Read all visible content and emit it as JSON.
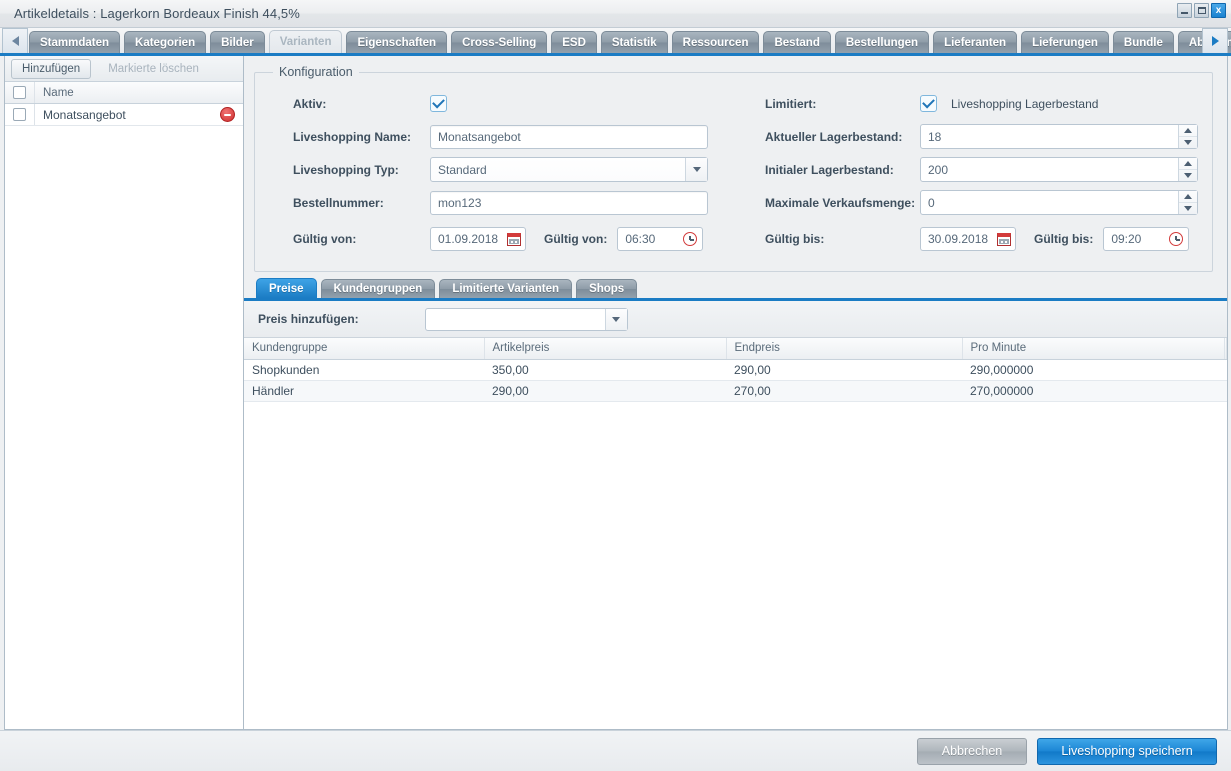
{
  "window": {
    "title": "Artikeldetails : Lagerkorn Bordeaux Finish 44,5%",
    "controls": {
      "minimize": "–",
      "maximize": "□",
      "close": "x"
    },
    "accent_color": "#1b7cc4"
  },
  "tabbar": {
    "scroll_left_icon": "arrow-left-icon",
    "scroll_right_icon": "arrow-right-icon",
    "tabs": [
      {
        "label": "Stammdaten",
        "active": false
      },
      {
        "label": "Kategorien",
        "active": false
      },
      {
        "label": "Bilder",
        "active": false
      },
      {
        "label": "Varianten",
        "active": true
      },
      {
        "label": "Eigenschaften",
        "active": false
      },
      {
        "label": "Cross-Selling",
        "active": false
      },
      {
        "label": "ESD",
        "active": false
      },
      {
        "label": "Statistik",
        "active": false
      },
      {
        "label": "Ressourcen",
        "active": false
      },
      {
        "label": "Bestand",
        "active": false
      },
      {
        "label": "Bestellungen",
        "active": false
      },
      {
        "label": "Lieferanten",
        "active": false
      },
      {
        "label": "Lieferungen",
        "active": false
      },
      {
        "label": "Bundle",
        "active": false
      },
      {
        "label": "AboCommerce",
        "active": false
      }
    ]
  },
  "left_panel": {
    "toolbar": {
      "add_label": "Hinzufügen",
      "delete_marked_label": "Markierte löschen"
    },
    "grid": {
      "column_header": "Name",
      "rows": [
        {
          "name": "Monatsangebot"
        }
      ]
    }
  },
  "config": {
    "legend": "Konfiguration",
    "left_fields": {
      "aktiv_label": "Aktiv:",
      "aktiv_checked": true,
      "name_label": "Liveshopping Name:",
      "name_value": "Monatsangebot",
      "typ_label": "Liveshopping Typ:",
      "typ_value": "Standard",
      "bestellnummer_label": "Bestellnummer:",
      "bestellnummer_value": "mon123",
      "gueltig_von_date_label": "Gültig von:",
      "gueltig_von_date_value": "01.09.2018",
      "gueltig_von_time_label": "Gültig von:",
      "gueltig_von_time_value": "06:30"
    },
    "right_fields": {
      "limitiert_label": "Limitiert:",
      "limitiert_checked": true,
      "limitiert_caption": "Liveshopping Lagerbestand",
      "aktueller_label": "Aktueller Lagerbestand:",
      "aktueller_value": "18",
      "initialer_label": "Initialer Lagerbestand:",
      "initialer_value": "200",
      "maximale_label": "Maximale Verkaufsmenge:",
      "maximale_value": "0",
      "gueltig_bis_date_label": "Gültig bis:",
      "gueltig_bis_date_value": "30.09.2018",
      "gueltig_bis_time_label": "Gültig bis:",
      "gueltig_bis_time_value": "09:20"
    }
  },
  "subtabs": [
    {
      "label": "Preise",
      "active": true
    },
    {
      "label": "Kundengruppen",
      "active": false
    },
    {
      "label": "Limitierte Varianten",
      "active": false
    },
    {
      "label": "Shops",
      "active": false
    }
  ],
  "price_panel": {
    "add_label": "Preis hinzufügen:",
    "add_select_value": "",
    "columns": [
      "Kundengruppe",
      "Artikelpreis",
      "Endpreis",
      "Pro Minute"
    ],
    "rows": [
      {
        "kundengruppe": "Shopkunden",
        "artikelpreis": "350,00",
        "endpreis": "290,00",
        "pro_minute": "290,000000"
      },
      {
        "kundengruppe": "Händler",
        "artikelpreis": "290,00",
        "endpreis": "270,00",
        "pro_minute": "270,000000"
      }
    ]
  },
  "footer": {
    "cancel_label": "Abbrechen",
    "save_label": "Liveshopping speichern"
  }
}
